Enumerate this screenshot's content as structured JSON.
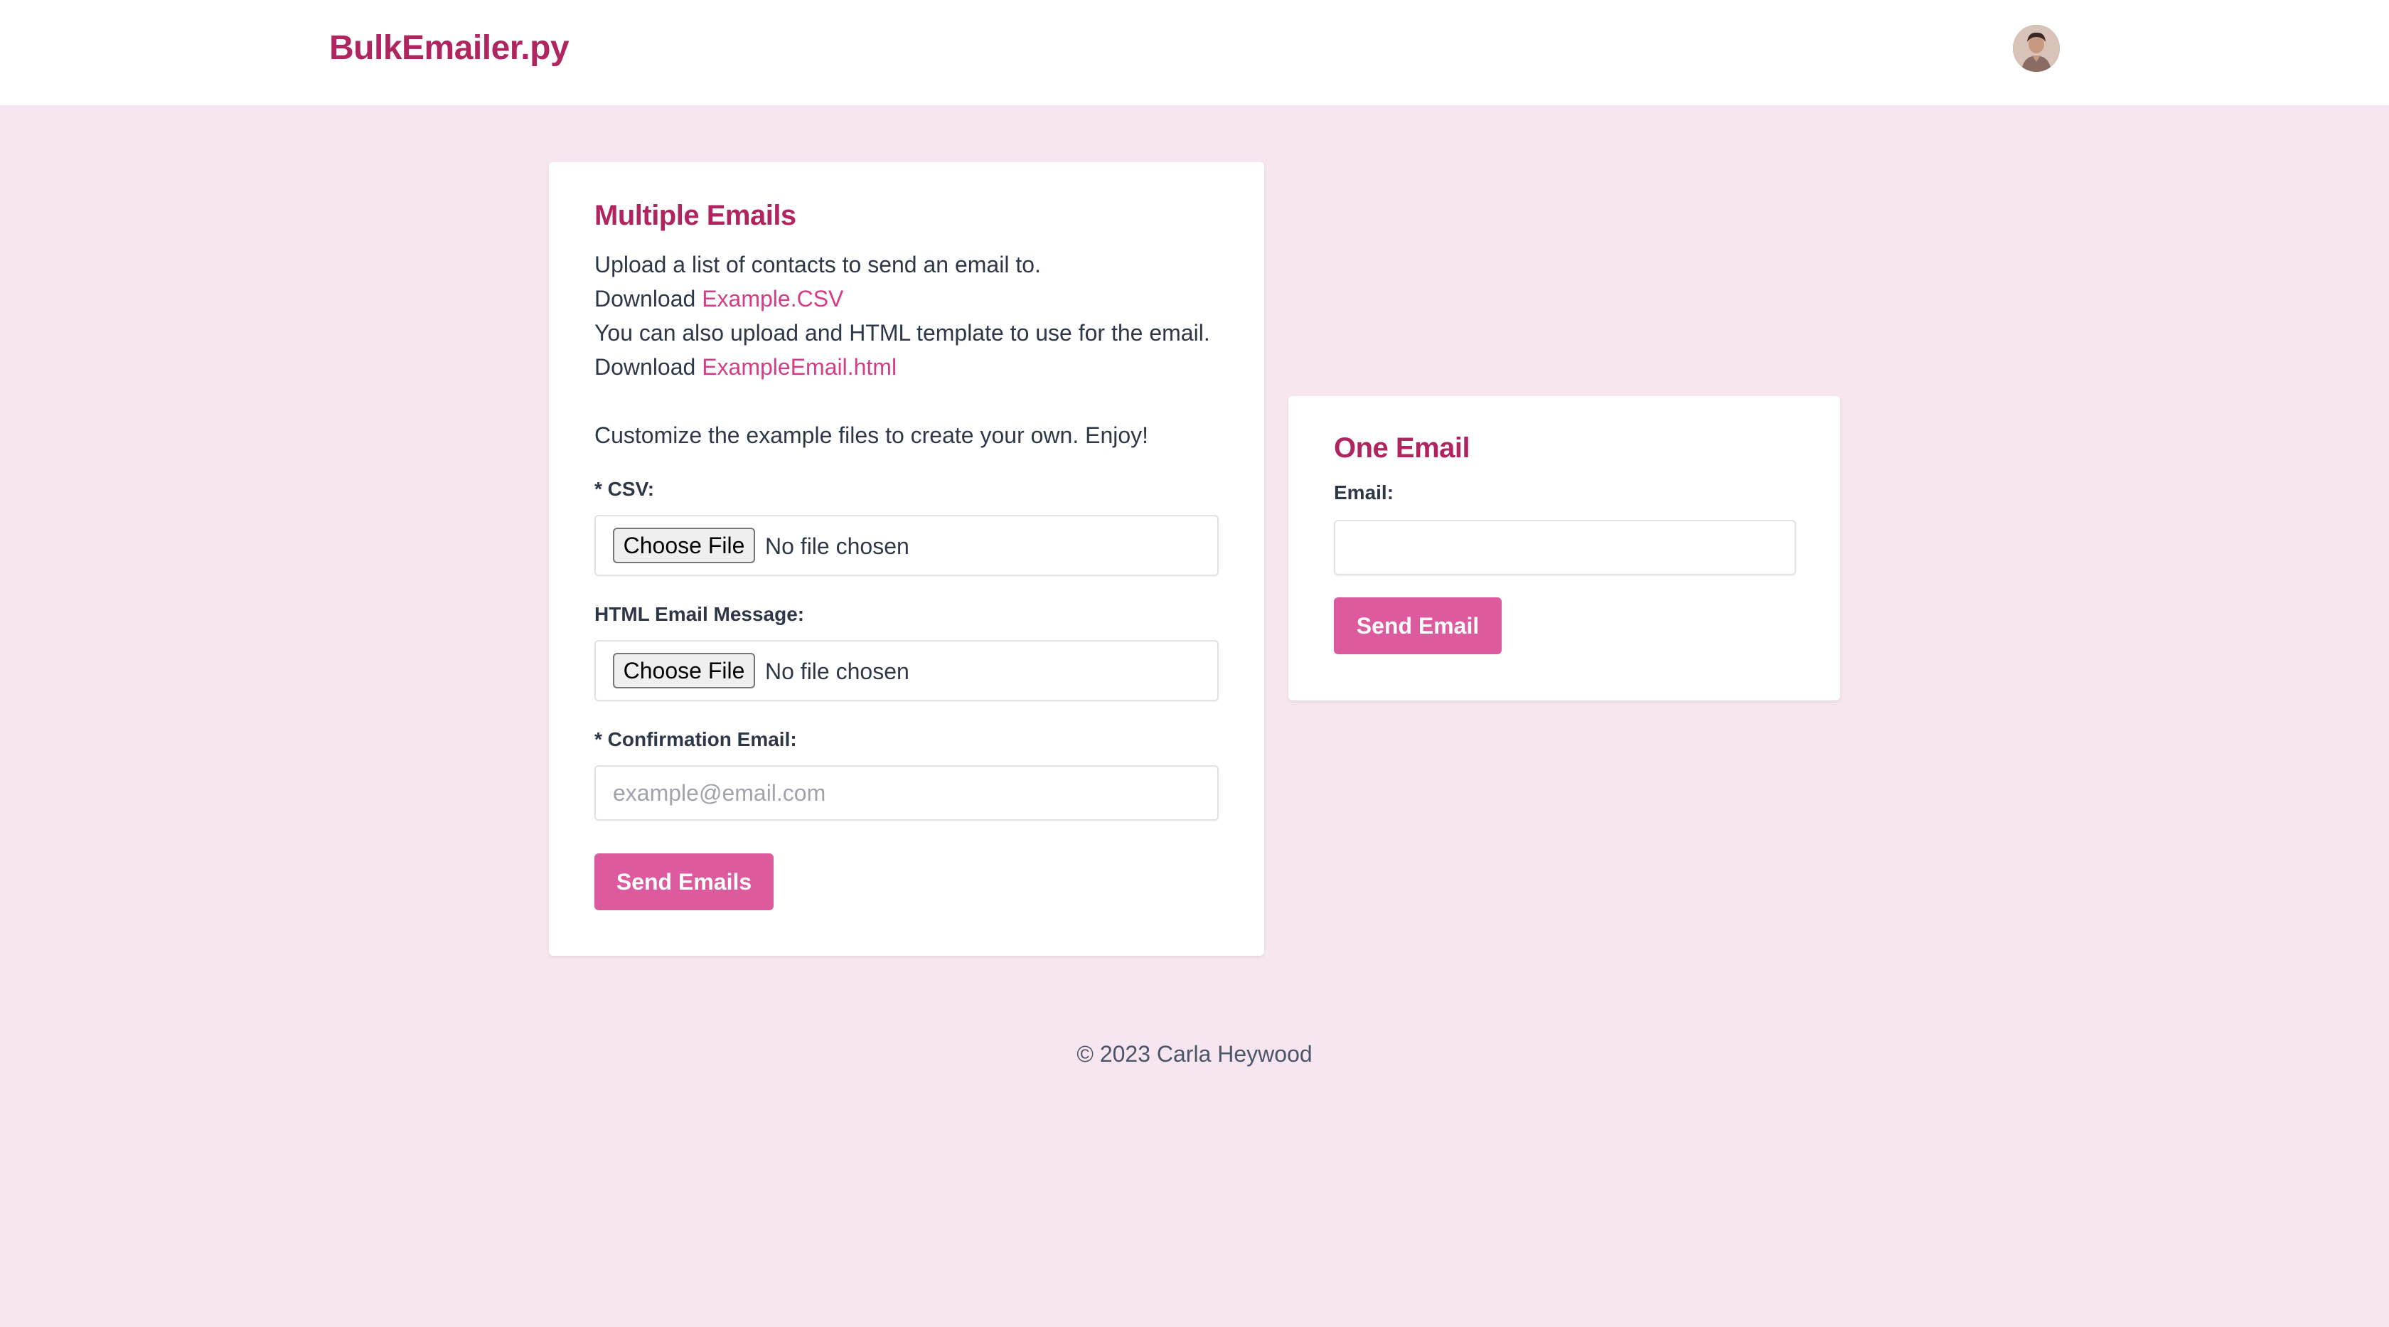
{
  "header": {
    "brand": "BulkEmailer.py",
    "avatar_icon": "user-avatar"
  },
  "multiple": {
    "title": "Multiple Emails",
    "line1": "Upload a list of contacts to send an email to.",
    "line2_prefix": "Download ",
    "line2_link": "Example.CSV",
    "line3": "You can also upload and HTML template to use for the email.",
    "line4_prefix": "Download ",
    "line4_link": "ExampleEmail.html",
    "line5": "Customize the example files to create your own. Enjoy!",
    "csv_label": "* CSV:",
    "csv_button": "Choose File",
    "csv_status": "No file chosen",
    "html_label": "HTML Email Message:",
    "html_button": "Choose File",
    "html_status": "No file chosen",
    "confirm_label": "* Confirmation Email:",
    "confirm_placeholder": "example@email.com",
    "confirm_value": "",
    "submit": "Send Emails"
  },
  "one": {
    "title": "One Email",
    "email_label": "Email:",
    "email_value": "",
    "submit": "Send Email"
  },
  "footer": {
    "text": "© 2023 Carla Heywood"
  },
  "colors": {
    "page_bg": "#f7e6f0",
    "brand": "#b0245f",
    "link": "#d63c86",
    "button": "#dc5a9d"
  }
}
